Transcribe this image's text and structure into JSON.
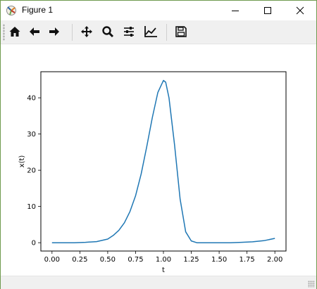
{
  "window": {
    "title": "Figure 1",
    "controls": {
      "minimize": "minimize",
      "maximize": "maximize",
      "close": "close"
    }
  },
  "toolbar": {
    "buttons": [
      {
        "name": "home",
        "icon": "home-icon"
      },
      {
        "name": "back",
        "icon": "arrow-left-icon"
      },
      {
        "name": "forward",
        "icon": "arrow-right-icon"
      },
      {
        "name": "pan",
        "icon": "move-icon"
      },
      {
        "name": "zoom",
        "icon": "magnifier-icon"
      },
      {
        "name": "configure-subplots",
        "icon": "sliders-icon"
      },
      {
        "name": "edit-axis",
        "icon": "line-chart-icon"
      },
      {
        "name": "save",
        "icon": "floppy-disk-icon"
      }
    ]
  },
  "chart_data": {
    "type": "line",
    "xlabel": "t",
    "ylabel": "x(t)",
    "xlim": [
      -0.1,
      2.1
    ],
    "ylim": [
      -2.3,
      47.2
    ],
    "xticks": [
      "0.00",
      "0.25",
      "0.50",
      "0.75",
      "1.00",
      "1.25",
      "1.50",
      "1.75",
      "2.00"
    ],
    "yticks": [
      "0",
      "10",
      "20",
      "30",
      "40"
    ],
    "grid": false,
    "series": [
      {
        "color": "#1f77b4",
        "x": [
          0.0,
          0.1,
          0.2,
          0.3,
          0.4,
          0.5,
          0.55,
          0.6,
          0.65,
          0.7,
          0.75,
          0.8,
          0.85,
          0.9,
          0.95,
          1.0,
          1.02,
          1.05,
          1.1,
          1.15,
          1.2,
          1.25,
          1.3,
          1.4,
          1.5,
          1.6,
          1.7,
          1.8,
          1.9,
          2.0
        ],
        "y": [
          0.0,
          0.0,
          0.0,
          0.1,
          0.3,
          1.0,
          2.0,
          3.4,
          5.5,
          8.6,
          13.0,
          19.0,
          26.5,
          34.5,
          41.5,
          44.8,
          44.3,
          40.0,
          27.0,
          12.0,
          3.0,
          0.5,
          0.0,
          0.0,
          0.0,
          0.0,
          0.1,
          0.25,
          0.55,
          1.2
        ]
      }
    ]
  },
  "colors": {
    "window_border": "#6f9a4f",
    "toolbar_bg": "#f0f0f0",
    "line": "#1f77b4"
  }
}
